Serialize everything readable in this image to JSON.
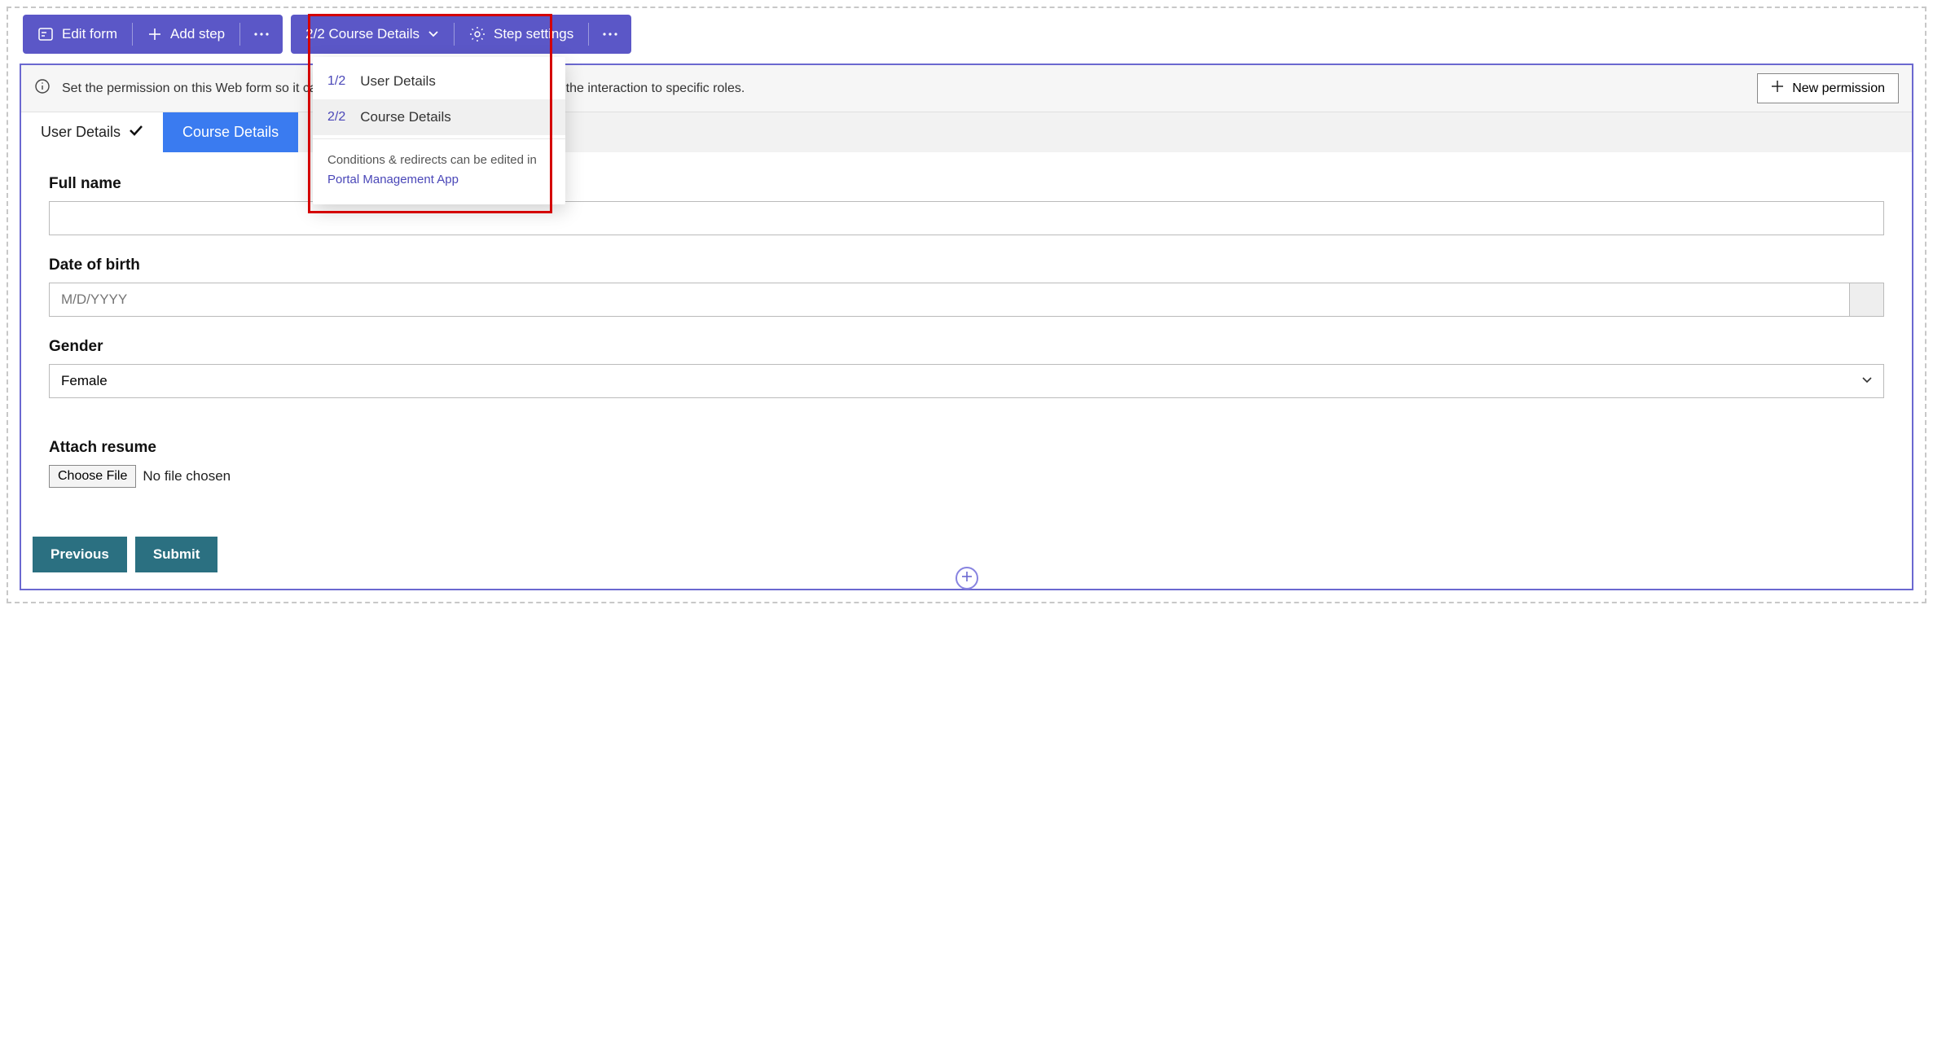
{
  "toolbar1": {
    "edit_form": "Edit form",
    "add_step": "Add step"
  },
  "toolbar2": {
    "step_selector": "2/2 Course Details",
    "step_settings": "Step settings"
  },
  "dropdown": {
    "items": [
      {
        "num": "1/2",
        "label": "User Details"
      },
      {
        "num": "2/2",
        "label": "Course Details"
      }
    ],
    "footer_text": "Conditions & redirects can be edited in",
    "footer_link": "Portal Management App"
  },
  "notice": {
    "text": "Set the permission on this Web form so it can appear on the portal for the users or limit the interaction to specific roles.",
    "button": "New permission"
  },
  "tabs": {
    "user_details": "User Details",
    "course_details": "Course Details"
  },
  "form": {
    "full_name": {
      "label": "Full name",
      "value": ""
    },
    "date_of_birth": {
      "label": "Date of birth",
      "placeholder": "M/D/YYYY"
    },
    "gender": {
      "label": "Gender",
      "value": "Female"
    },
    "attach_resume": {
      "label": "Attach resume",
      "button": "Choose File",
      "status": "No file chosen"
    }
  },
  "actions": {
    "previous": "Previous",
    "submit": "Submit"
  }
}
